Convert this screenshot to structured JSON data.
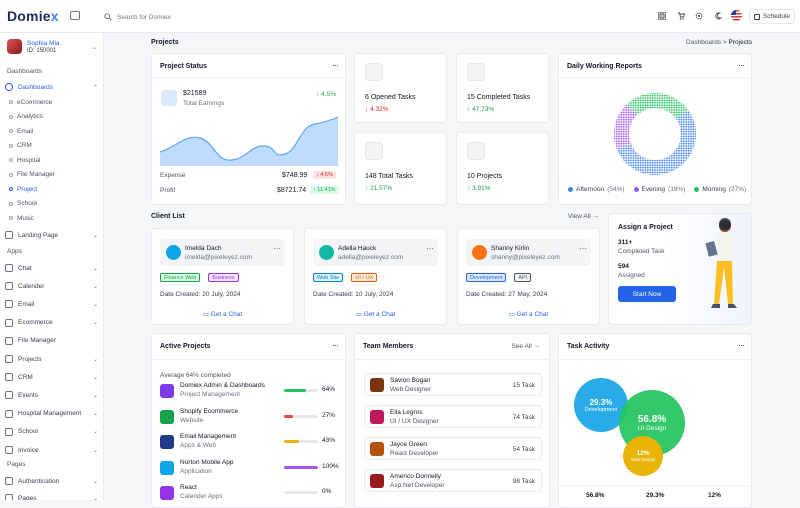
{
  "brand": {
    "name_a": "Domie",
    "name_b": "x"
  },
  "search": {
    "placeholder": "Search for Domiex"
  },
  "topbar": {
    "schedule_label": "Schedule"
  },
  "profile": {
    "name": "Sophia Mia",
    "id": "ID: 150001"
  },
  "sidebar": {
    "sections": {
      "dashboards": "Dashboards",
      "apps": "Apps",
      "pages": "Pages"
    },
    "dashboards_label": "Dashboards",
    "dash_items": [
      "eCommerce",
      "Analytics",
      "Email",
      "CRM",
      "Hospital",
      "File Manager",
      "Project",
      "School",
      "Music"
    ],
    "landing": "Landing Page",
    "apps": [
      "Chat",
      "Calender",
      "Email",
      "Ecommerce",
      "File Manager",
      "Projects",
      "CRM",
      "Events",
      "Hospital Management",
      "School",
      "Invoice"
    ],
    "pages": [
      "Authentication",
      "Pages"
    ]
  },
  "page": {
    "title": "Projects",
    "crumb_parent": "Dashboards",
    "crumb_current": "Projects"
  },
  "project_status": {
    "title": "Project Status",
    "earnings_value": "$21589",
    "earnings_label": "Total Earnings",
    "earnings_change": "4.5%",
    "expense_label": "Expense",
    "expense_value": "$748.99",
    "expense_change": "4.5%",
    "profit_label": "Profit",
    "profit_value": "$8721.74",
    "profit_change": "11.41%"
  },
  "stats": [
    {
      "value": "6 Opened Tasks",
      "change": "4.32%",
      "dir": "down"
    },
    {
      "value": "15 Completed Tasks",
      "change": "47.73%",
      "dir": "up"
    },
    {
      "value": "148 Total Tasks",
      "change": "21.57%",
      "dir": "up"
    },
    {
      "value": "10 Projects",
      "change": "3.91%",
      "dir": "up"
    }
  ],
  "daily_reports": {
    "title": "Daily Working Reports",
    "legend": [
      {
        "name": "Afternoon",
        "pct": "(54%)",
        "color": "#3b82f6"
      },
      {
        "name": "Evening",
        "pct": "(19%)",
        "color": "#8b5cf6"
      },
      {
        "name": "Morning",
        "pct": "(27%)",
        "color": "#22c55e"
      }
    ]
  },
  "chart_data": {
    "type": "pie",
    "title": "Daily Working Reports",
    "categories": [
      "Afternoon",
      "Evening",
      "Morning"
    ],
    "values": [
      54,
      19,
      27
    ],
    "colors": [
      "#3b82f6",
      "#a855f7",
      "#22c55e"
    ]
  },
  "client_list": {
    "title": "Client List",
    "view_all": "View All",
    "date_label": "Date Created:",
    "chat_label": "Get a Chat",
    "clients": [
      {
        "name": "Imelda Dach",
        "email": "imelda@pixeleyez.com",
        "tags": [
          "Finance Web",
          "Business"
        ],
        "date": "20 July, 2024"
      },
      {
        "name": "Adella Hauck",
        "email": "adella@pixeleyez.com",
        "tags": [
          "Web Site",
          "UI / UX"
        ],
        "date": "10 July, 2024"
      },
      {
        "name": "Shanny Kirlin",
        "email": "shanny@pixeleyez.com",
        "tags": [
          "Development",
          "API"
        ],
        "date": "27 May, 2024"
      }
    ]
  },
  "assign": {
    "title": "Assign a Project",
    "completed_value": "311+",
    "completed_label": "Completed Task",
    "assigned_value": "594",
    "assigned_label": "Assigned",
    "button": "Start Now"
  },
  "active_projects": {
    "title": "Active Projects",
    "average": "Average 64% completed",
    "items": [
      {
        "name": "Domiex Admin & Dashboards",
        "type": "Project Management",
        "pct": "64%",
        "level": 0.64,
        "color": "#22c55e",
        "icon_color": "#7c3aed"
      },
      {
        "name": "Shopify Ecommerce",
        "type": "Website",
        "pct": "27%",
        "level": 0.27,
        "color": "#ef4444",
        "icon_color": "#16a34a"
      },
      {
        "name": "Email Management",
        "type": "Apps & Web",
        "pct": "43%",
        "level": 0.43,
        "color": "#eab308",
        "icon_color": "#1e3a8a"
      },
      {
        "name": "Norton Mobile App",
        "type": "Application",
        "pct": "100%",
        "level": 1.0,
        "color": "#a855f7",
        "icon_color": "#0ea5e9"
      },
      {
        "name": "React",
        "type": "Calender Apps",
        "pct": "0%",
        "level": 0,
        "color": "#3b82f6",
        "icon_color": "#9333ea"
      }
    ]
  },
  "team": {
    "title": "Team Members",
    "see_all": "See All",
    "members": [
      {
        "name": "Savion Bogan",
        "role": "Web Designer",
        "tasks": "15 Task",
        "color": "#78350f"
      },
      {
        "name": "Ella Legros",
        "role": "UI / UX Designer",
        "tasks": "74 Task",
        "color": "#be185d"
      },
      {
        "name": "Jayce Green",
        "role": "React Developer",
        "tasks": "54 Task",
        "color": "#b45309"
      },
      {
        "name": "Americo Donnelly",
        "role": "Asp.Net Developer",
        "tasks": "98 Task",
        "color": "#991b1b"
      }
    ]
  },
  "task_activity": {
    "title": "Task Activity",
    "bubbles": [
      {
        "value": "29.3%",
        "label": "Development",
        "color": "#1ea7e7"
      },
      {
        "value": "56.8%",
        "label": "UI Design",
        "color": "#22c55e"
      },
      {
        "value": "12%",
        "label": "Web Design",
        "color": "#eab308"
      }
    ],
    "footer": [
      "56.8%",
      "29.3%",
      "12%"
    ]
  }
}
